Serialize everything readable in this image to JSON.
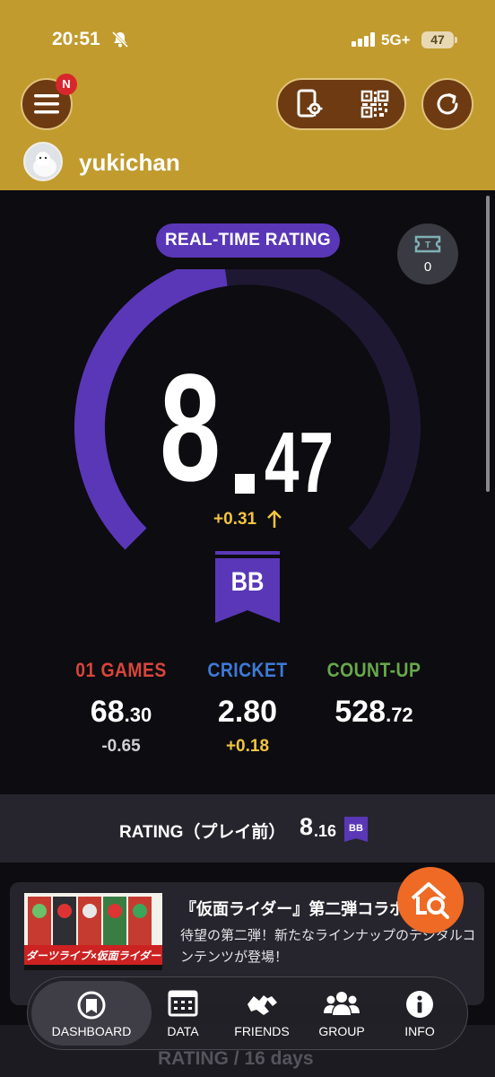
{
  "status_bar": {
    "time": "20:51",
    "network": "5G+",
    "battery": "47"
  },
  "header": {
    "menu_badge": "N",
    "username": "yukichan"
  },
  "rating": {
    "label": "REAL-TIME RATING",
    "value_int": "8",
    "value_dec": "47",
    "delta": "+0.31",
    "class": "BB",
    "gauge_fill_fraction": 0.47,
    "ticket_count": "0"
  },
  "games": [
    {
      "title": "01 GAMES",
      "int": "68",
      "dec": "30",
      "delta": "-0.65",
      "title_color": "#d9453b",
      "delta_color": "#cfcfd4"
    },
    {
      "title": "CRICKET",
      "int": "2.80",
      "dec": "",
      "delta": "+0.18",
      "title_color": "#3d7ad6",
      "delta_color": "#f2c441"
    },
    {
      "title": "COUNT-UP",
      "int": "528",
      "dec": "72",
      "delta": "",
      "title_color": "#67a94a",
      "delta_color": "#cfcfd4"
    }
  ],
  "pre_play": {
    "label": "RATING（プレイ前）",
    "int": "8",
    "dec": "16",
    "class": "BB"
  },
  "news": {
    "title": "『仮面ライダー』第二弾コラボ",
    "body": "待望の第二弾！新たなラインナップのデジタルコンテンツが登場！",
    "image_text": "ダーツライブ×仮面ライダー"
  },
  "bottom_hint": "RATING / 16 days",
  "nav": [
    {
      "label": "DASHBOARD",
      "icon": "dashboard-icon"
    },
    {
      "label": "DATA",
      "icon": "data-icon"
    },
    {
      "label": "FRIENDS",
      "icon": "friends-icon"
    },
    {
      "label": "GROUP",
      "icon": "group-icon"
    },
    {
      "label": "INFO",
      "icon": "info-icon"
    }
  ],
  "colors": {
    "header": "#c19b2e",
    "accent_purple": "#5a37b7",
    "background": "#0d0c10",
    "fab": "#ee6a25"
  }
}
